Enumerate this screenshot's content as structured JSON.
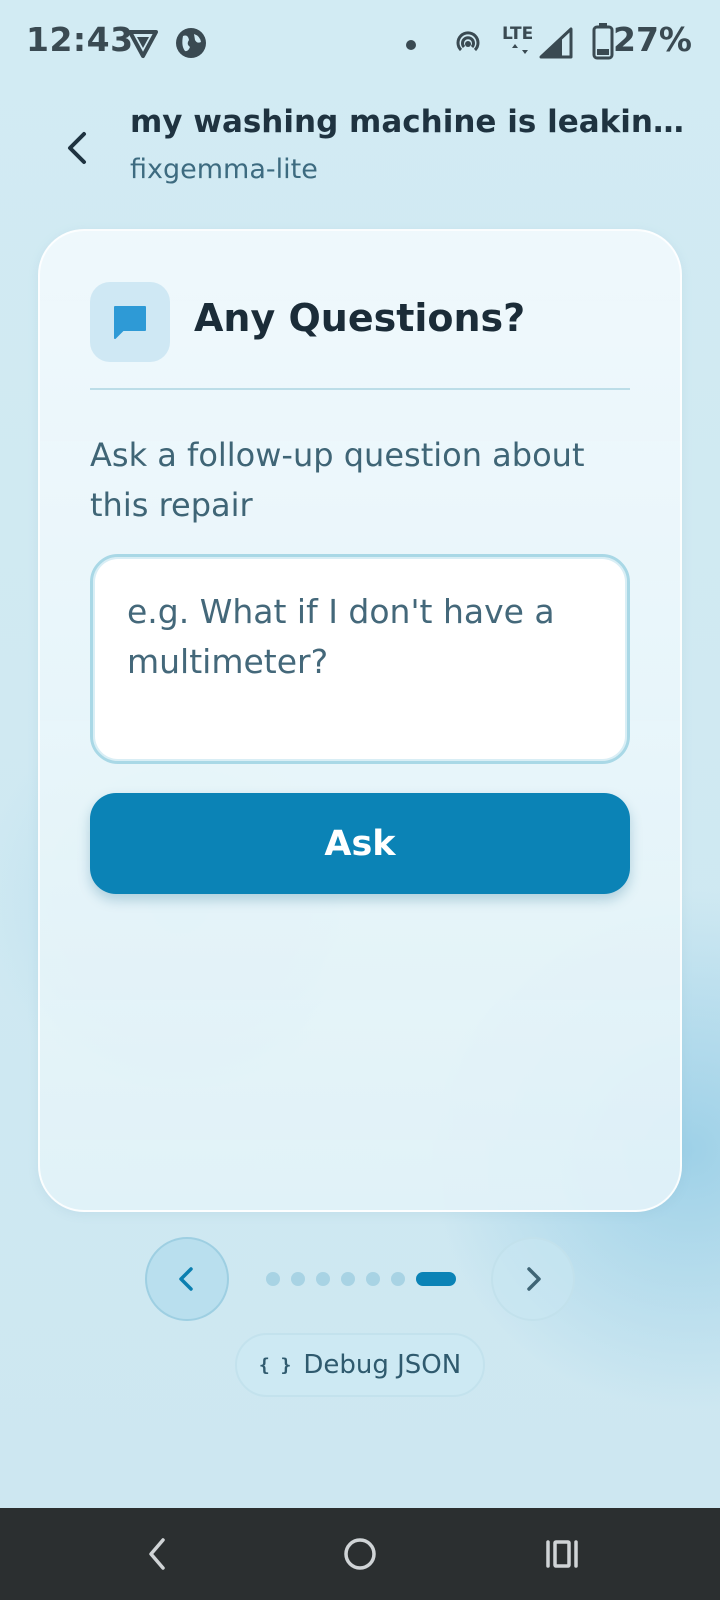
{
  "status_bar": {
    "time": "12:43",
    "battery": "27%",
    "network": "LTE"
  },
  "header": {
    "title": "my washing machine is leaking w...",
    "subtitle": "fixgemma-lite"
  },
  "card": {
    "title": "Any Questions?",
    "prompt": "Ask a follow-up question about this repair",
    "input_placeholder": "e.g. What if I don't have a multimeter?",
    "input_value": "",
    "ask_label": "Ask"
  },
  "pager": {
    "total_pages": 7,
    "current_page": 7
  },
  "debug": {
    "label": "Debug JSON",
    "icon": "{ }"
  },
  "icons": {
    "status": [
      "vpn-shield-icon",
      "globe-icon",
      "notification-dot-icon",
      "hotspot-icon",
      "signal-icon",
      "battery-icon"
    ],
    "card": "chat-bubble-icon",
    "nav": [
      "nav-back-icon",
      "nav-home-icon",
      "nav-recents-icon"
    ]
  },
  "colors": {
    "accent": "#0b83b6",
    "background": "#cfe9f2",
    "chat_icon": "#2e9ad6"
  }
}
